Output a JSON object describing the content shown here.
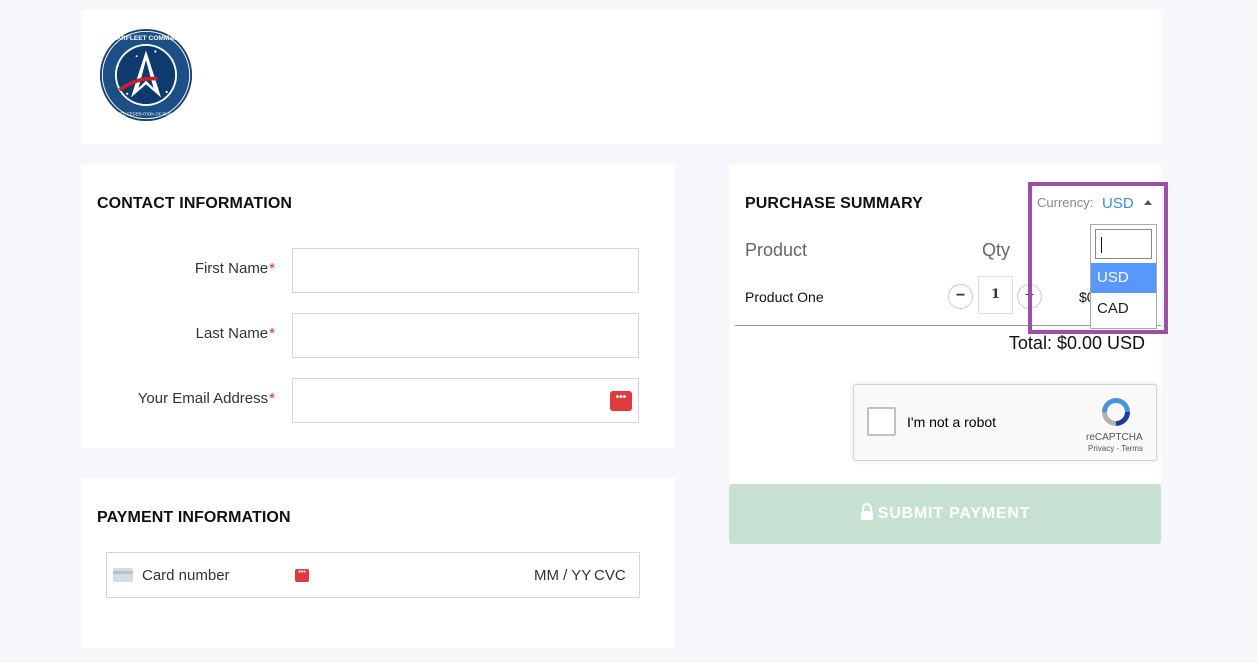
{
  "header": {
    "logo_text_top": "STARFLEET COMMAND",
    "logo_text_bottom": "UNITED FEDERATION OF PLANETS"
  },
  "contact": {
    "title": "CONTACT INFORMATION",
    "required_marker": "*",
    "fields": [
      {
        "label": "First Name",
        "value": ""
      },
      {
        "label": "Last Name",
        "value": ""
      },
      {
        "label": "Your Email Address",
        "value": ""
      }
    ]
  },
  "payment": {
    "title": "PAYMENT INFORMATION",
    "card_number_placeholder": "Card number",
    "expiry_placeholder": "MM / YY",
    "cvc_placeholder": "CVC"
  },
  "summary": {
    "title": "PURCHASE SUMMARY",
    "product_header": "Product",
    "qty_header": "Qty",
    "items": [
      {
        "name": "Product One",
        "qty": "1",
        "price": "$0.00"
      }
    ],
    "qty_minus": "−",
    "qty_plus": "+",
    "total": "Total: $0.00 USD"
  },
  "currency": {
    "label": "Currency:",
    "selected": "USD",
    "search_value": "",
    "options": [
      "USD",
      "CAD"
    ],
    "highlight_color": "#9b4fa5"
  },
  "recaptcha": {
    "label": "I'm not a robot",
    "brand": "reCAPTCHA",
    "links": "Privacy - Terms"
  },
  "submit": {
    "label": "SUBMIT PAYMENT"
  },
  "colors": {
    "required": "#d9262b",
    "accent_link": "#3e8ed0",
    "option_highlight": "#5897fb",
    "submit_bg": "#c6e1d4"
  }
}
